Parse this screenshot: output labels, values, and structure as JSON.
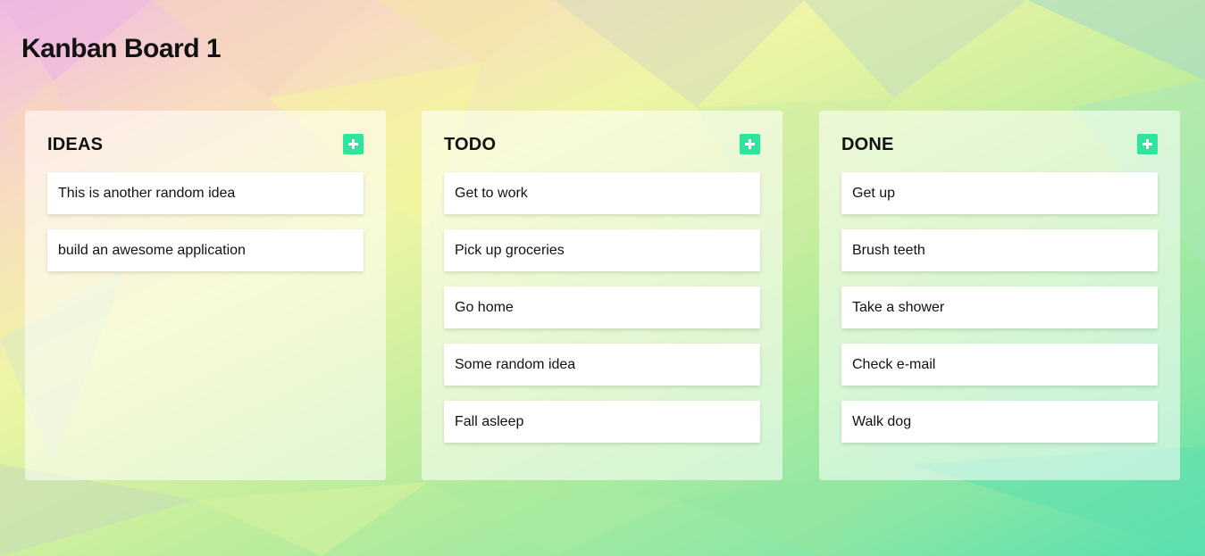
{
  "board": {
    "title": "Kanban Board 1"
  },
  "columns": [
    {
      "title": "IDEAS",
      "add_icon": "plus-icon",
      "cards": [
        "This is another random idea",
        "build an awesome application"
      ]
    },
    {
      "title": "TODO",
      "add_icon": "plus-icon",
      "cards": [
        "Get to work",
        "Pick up groceries",
        "Go home",
        "Some random idea",
        "Fall asleep"
      ]
    },
    {
      "title": "DONE",
      "add_icon": "plus-icon",
      "cards": [
        "Get up",
        "Brush teeth",
        "Take a shower",
        "Check e-mail",
        "Walk dog"
      ]
    }
  ],
  "colors": {
    "accent": "#2ee59d",
    "card_background": "#ffffff"
  }
}
